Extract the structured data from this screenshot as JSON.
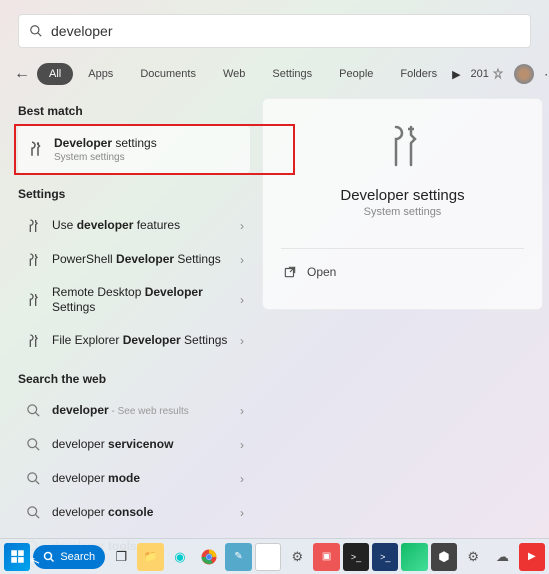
{
  "search": {
    "value": "developer"
  },
  "tabs": {
    "items": [
      "All",
      "Apps",
      "Documents",
      "Web",
      "Settings",
      "People",
      "Folders"
    ],
    "points": "201"
  },
  "sections": {
    "best_match": {
      "header": "Best match",
      "item": {
        "title_bold": "Developer",
        "title_rest": " settings",
        "subtitle": "System settings"
      }
    },
    "settings": {
      "header": "Settings",
      "items": [
        {
          "pre": "Use ",
          "bold": "developer",
          "post": " features"
        },
        {
          "pre": "PowerShell ",
          "bold": "Developer",
          "post": " Settings"
        },
        {
          "pre": "Remote Desktop ",
          "bold": "Developer",
          "post": " Settings"
        },
        {
          "pre": "File Explorer ",
          "bold": "Developer",
          "post": " Settings"
        }
      ]
    },
    "search_web": {
      "header": "Search the web",
      "items": [
        {
          "bold": "developer",
          "post": "",
          "hint": " - See web results"
        },
        {
          "bold": "",
          "pre": "developer ",
          "boldpart": "servicenow"
        },
        {
          "bold": "",
          "pre": "developer ",
          "boldpart": "mode"
        },
        {
          "bold": "",
          "pre": "developer ",
          "boldpart": "console"
        },
        {
          "bold": "",
          "pre": "developer ",
          "boldpart": "tools"
        }
      ]
    }
  },
  "preview": {
    "title": "Developer settings",
    "subtitle": "System settings",
    "action": "Open"
  },
  "taskbar": {
    "search_label": "Search"
  }
}
